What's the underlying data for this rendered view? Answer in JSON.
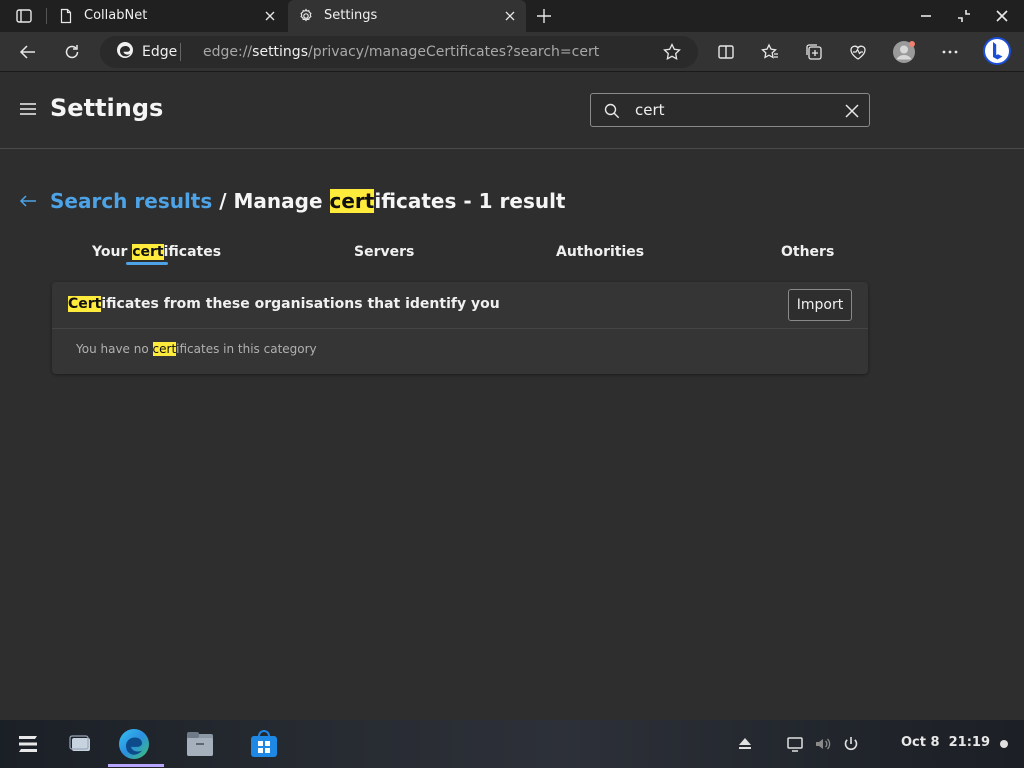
{
  "tabs": [
    {
      "label": "CollabNet",
      "icon": "page-icon"
    },
    {
      "label": "Settings",
      "icon": "gear-icon"
    }
  ],
  "omnibox": {
    "chip_label": "Edge",
    "url_scheme": "edge://",
    "url_host": "settings",
    "url_path": "/privacy/manageCertificates?search=cert"
  },
  "settings": {
    "title": "Settings",
    "search_value": "cert",
    "search_placeholder": "Search settings"
  },
  "breadcrumb": {
    "link": "Search results",
    "slash": " / Manage ",
    "highlight": "cert",
    "rest": "ificates - 1 result"
  },
  "cert_tabs": [
    {
      "pre": "Your ",
      "highlight": "cert",
      "post": "ificates"
    },
    {
      "label": "Servers"
    },
    {
      "label": "Authorities"
    },
    {
      "label": "Others"
    }
  ],
  "card": {
    "title_highlight": "Cert",
    "title_rest": "ificates from these organisations that identify you",
    "import_label": "Import",
    "empty_pre": "You have no ",
    "empty_highlight": "cert",
    "empty_post": "ificates in this category"
  },
  "taskbar": {
    "date": "Oct 8",
    "time": "21:19"
  },
  "colors": {
    "accent": "#4da3e6",
    "highlight": "#ffeb3b"
  }
}
